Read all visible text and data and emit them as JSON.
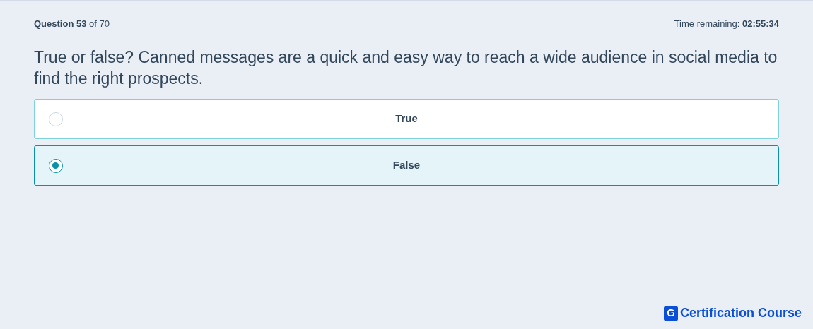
{
  "header": {
    "question_label": "**Question 53** of 70",
    "timer": "Time remaining: **02:55:34**"
  },
  "question": "True or false? Canned messages are a quick and easy way to reach a wide audience in social media to find the right prospects.",
  "options": [
    {
      "label": "True",
      "selected": false
    },
    {
      "label": "False",
      "selected": true
    }
  ],
  "brand": {
    "letter": "G",
    "name": "Certification Course"
  }
}
